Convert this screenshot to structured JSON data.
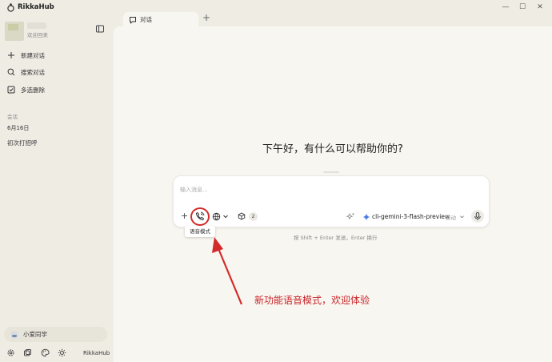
{
  "app": {
    "title": "RikkaHub"
  },
  "window_controls": {
    "minimize": "—",
    "maximize": "☐",
    "close": "✕"
  },
  "sidebar": {
    "welcome_text": "欢迎回来",
    "nav": [
      {
        "label": "新建对话",
        "icon": "plus-icon"
      },
      {
        "label": "搜索对话",
        "icon": "search-icon"
      },
      {
        "label": "多选删除",
        "icon": "checkbox-icon"
      }
    ],
    "section_label": "会话",
    "date_group": "6月16日",
    "conversations": [
      {
        "title": "初次打招呼"
      }
    ],
    "assistant": {
      "name": "小爱同学"
    },
    "brand": "RikkaHub"
  },
  "tabs": [
    {
      "label": "对话"
    }
  ],
  "tab_add": "+",
  "main": {
    "greeting": "下午好，有什么可以帮助你的?",
    "input_placeholder": "输入消息...",
    "plus_label": "+",
    "mcp_count": "2",
    "model_name": "cli-gemini-3-flash-preview",
    "model_mode": "自动",
    "tooltip": "语音模式",
    "send_hint": "按 Shift + Enter 发送，Enter 换行"
  },
  "annotation": {
    "text": "新功能语音模式，欢迎体验",
    "color": "#c9252a"
  },
  "colors": {
    "background": "#efece4",
    "panel": "#f8f6f0",
    "accent_red": "#d32b2b"
  }
}
